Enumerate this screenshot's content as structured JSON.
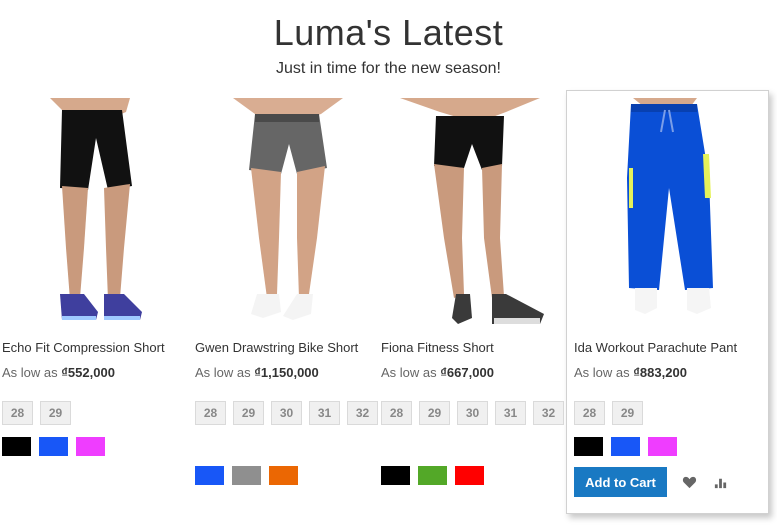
{
  "heading": {
    "title": "Luma's Latest",
    "subtitle": "Just in time for the new season!"
  },
  "products": [
    {
      "name": "Echo Fit Compression Short",
      "price_prefix": "As low as",
      "price": "₫552,000",
      "sizes": [
        "28",
        "29"
      ],
      "colors": [
        {
          "name": "black",
          "hex": "#000000"
        },
        {
          "name": "blue",
          "hex": "#1857f7"
        },
        {
          "name": "purple",
          "hex": "#ef3dff"
        }
      ]
    },
    {
      "name": "Gwen Drawstring Bike Short",
      "price_prefix": "As low as",
      "price": "₫1,150,000",
      "sizes": [
        "28",
        "29",
        "30",
        "31",
        "32"
      ],
      "colors": [
        {
          "name": "blue",
          "hex": "#1857f7"
        },
        {
          "name": "gray",
          "hex": "#8f8f8f"
        },
        {
          "name": "orange",
          "hex": "#eb6703"
        }
      ]
    },
    {
      "name": "Fiona Fitness Short",
      "price_prefix": "As low as",
      "price": "₫667,000",
      "sizes": [
        "28",
        "29",
        "30",
        "31",
        "32"
      ],
      "colors": [
        {
          "name": "black",
          "hex": "#000000"
        },
        {
          "name": "green",
          "hex": "#53a828"
        },
        {
          "name": "red",
          "hex": "#ff0000"
        }
      ]
    },
    {
      "name": "Ida Workout Parachute Pant",
      "price_prefix": "As low as",
      "price": "₫883,200",
      "sizes": [
        "28",
        "29"
      ],
      "colors": [
        {
          "name": "black",
          "hex": "#000000"
        },
        {
          "name": "blue",
          "hex": "#1857f7"
        },
        {
          "name": "purple",
          "hex": "#ef3dff"
        }
      ],
      "actions": {
        "add_to_cart": "Add to Cart",
        "wishlist_icon": "heart-icon",
        "compare_icon": "bar-chart-icon"
      }
    }
  ]
}
